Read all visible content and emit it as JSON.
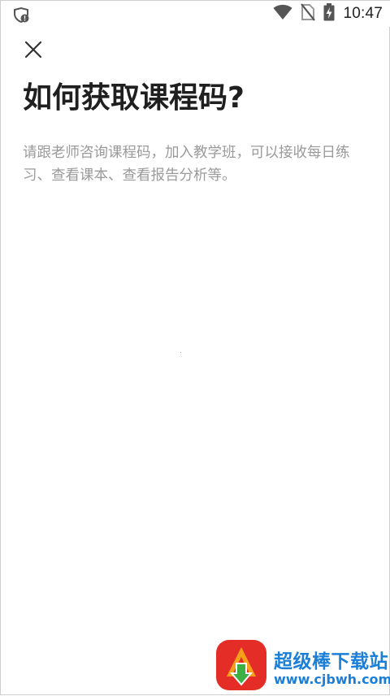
{
  "status_bar": {
    "time": "10:47",
    "left_icon": "wifi-shield-alert-icon",
    "right_icons": [
      "wifi-icon",
      "no-sim-icon",
      "battery-charging-icon"
    ]
  },
  "page": {
    "close_icon": "close-icon",
    "title": "如何获取课程码?",
    "description": "请跟老师咨询课程码，加入教学班，可以接收每日练习、查看课本、查看报告分析等。"
  },
  "watermark": {
    "title": "超级棒下载站",
    "url": "www.cjbwh.com",
    "colors": {
      "text": "#1b7fd8",
      "logo_red": "#e52d27",
      "logo_orange": "#f7a11a",
      "logo_green": "#3cb043"
    }
  }
}
